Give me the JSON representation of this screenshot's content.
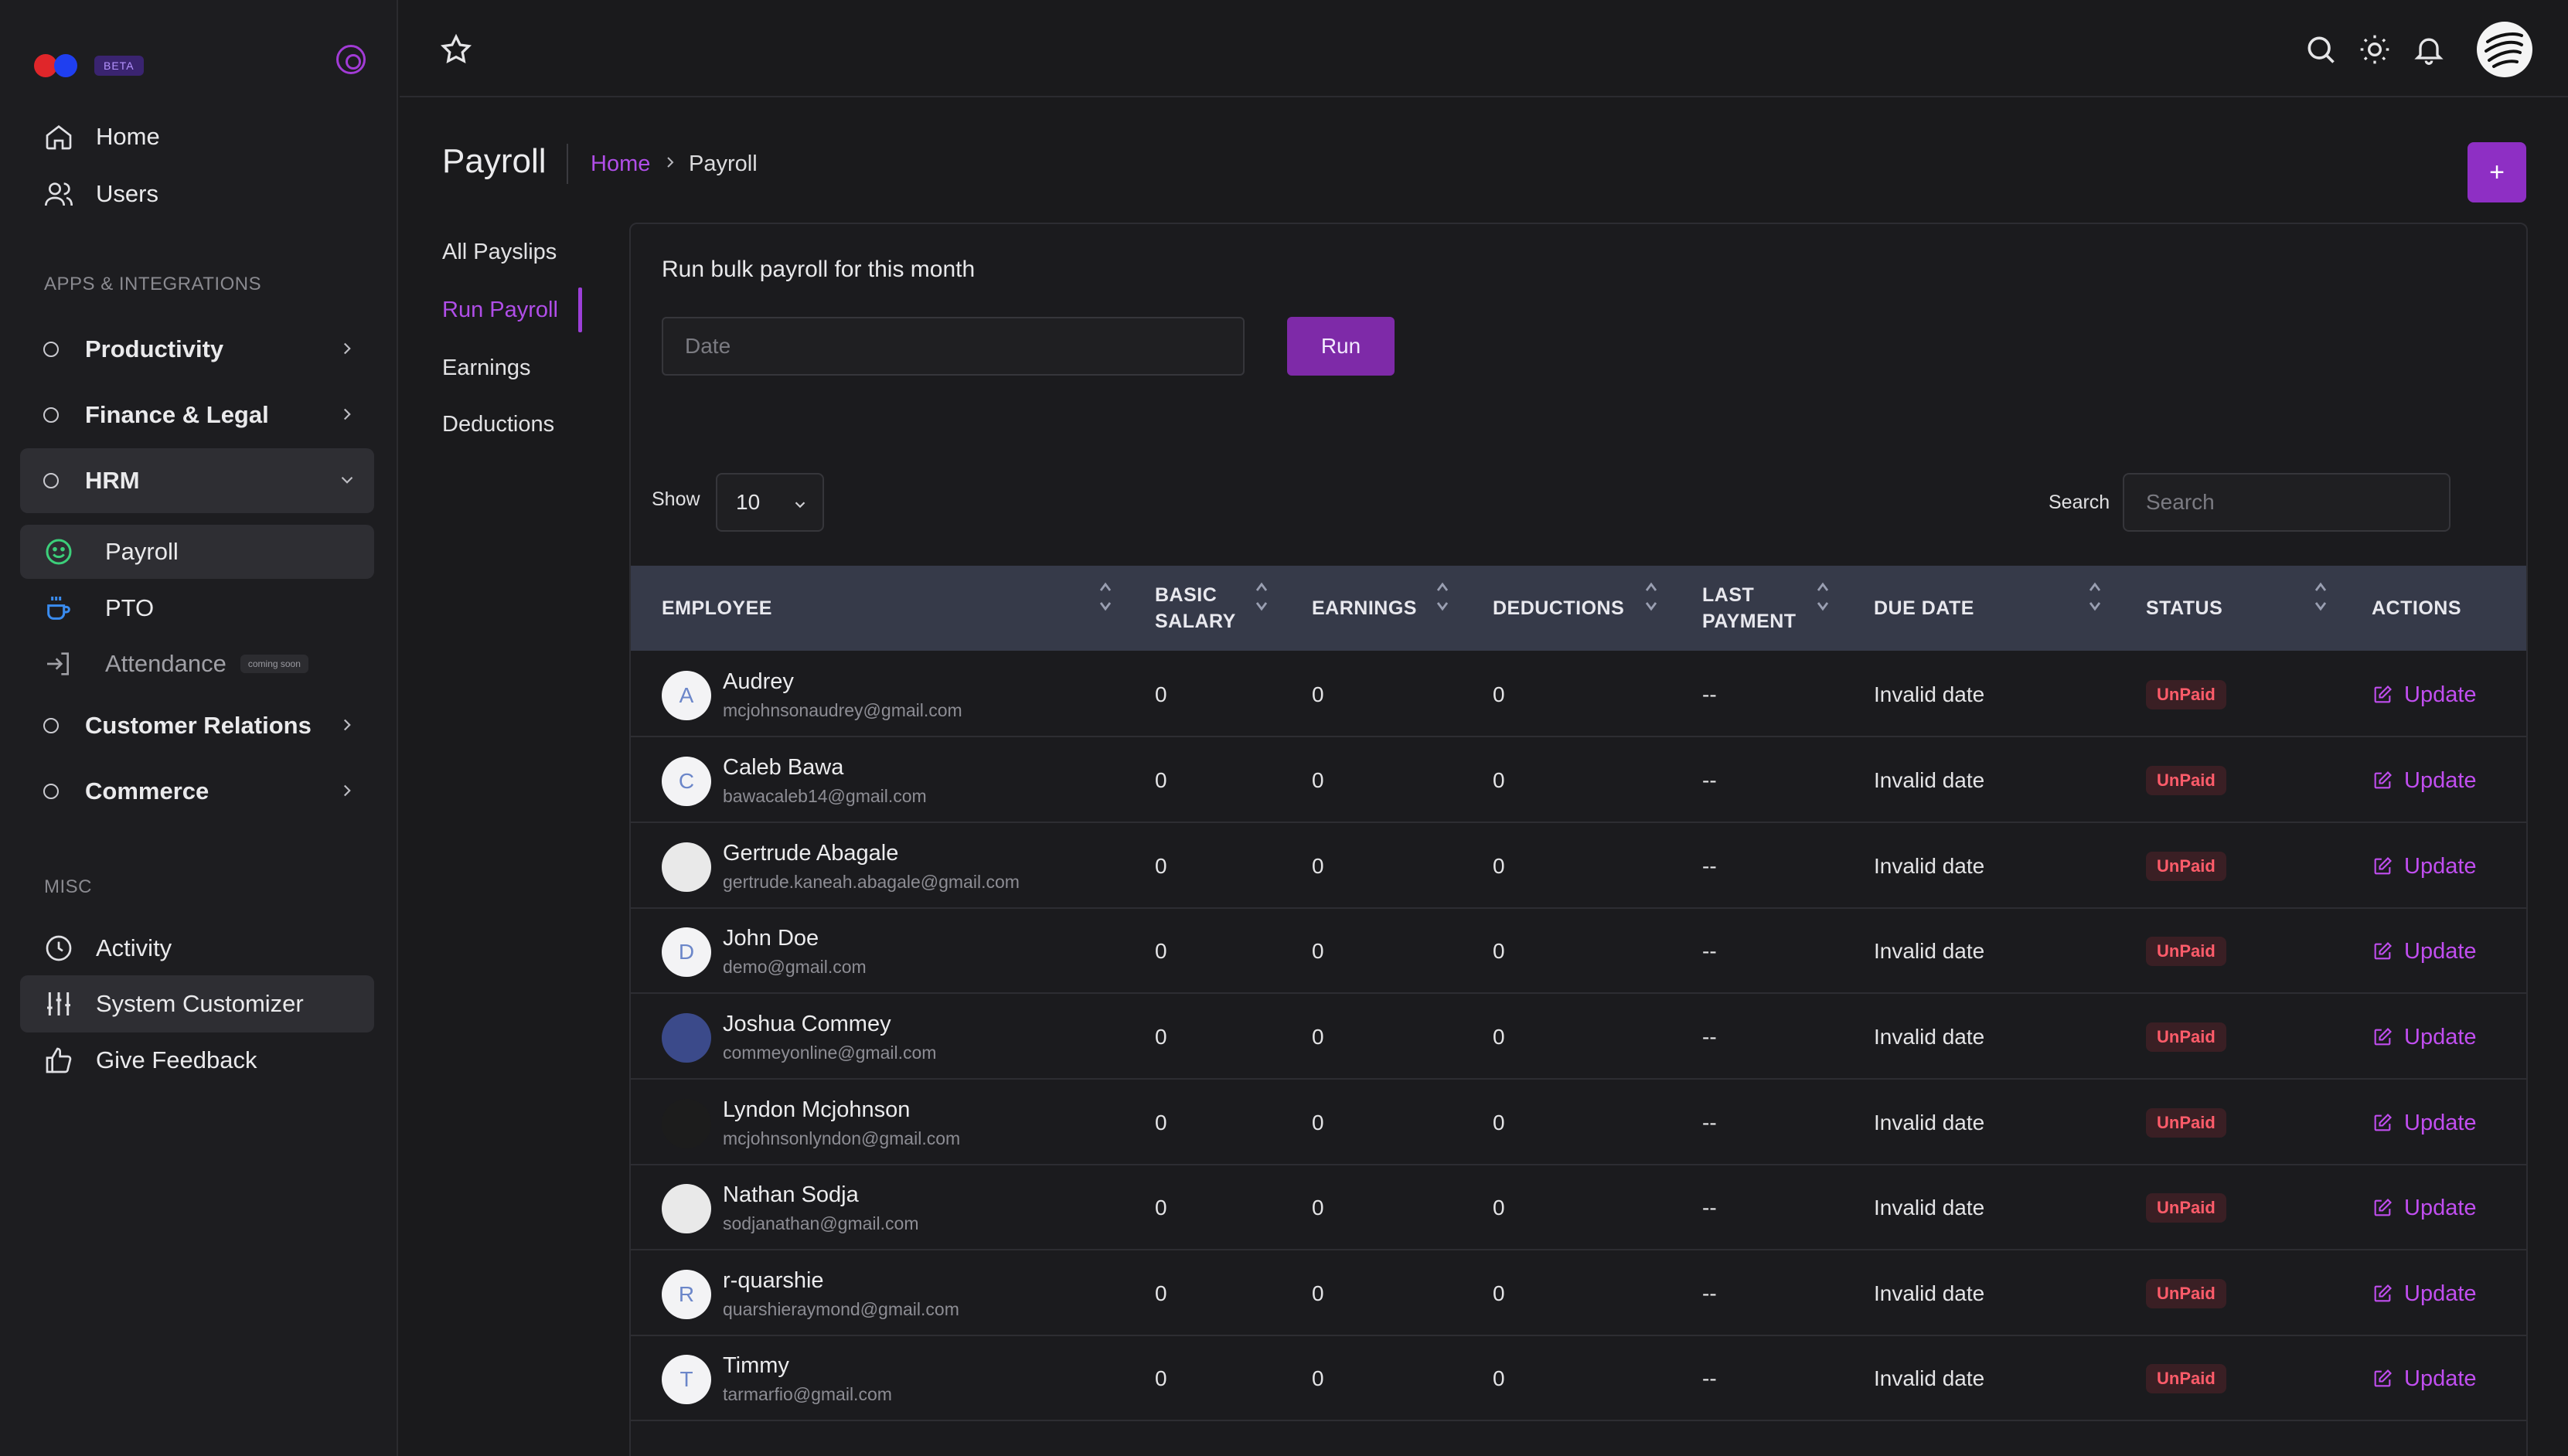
{
  "sidebar": {
    "beta": "BETA",
    "top_items": [
      {
        "label": "Home",
        "icon": "home-icon"
      },
      {
        "label": "Users",
        "icon": "users-icon"
      }
    ],
    "apps_label": "APPS & INTEGRATIONS",
    "groups": {
      "productivity": "Productivity",
      "finance": "Finance & Legal",
      "hrm": "HRM",
      "customer": "Customer Relations",
      "commerce": "Commerce"
    },
    "hrm_items": [
      {
        "label": "Payroll",
        "icon": "smile-icon"
      },
      {
        "label": "PTO",
        "icon": "coffee-icon"
      },
      {
        "label": "Attendance",
        "icon": "sign-in-icon",
        "badge": "coming soon"
      }
    ],
    "misc_label": "MISC",
    "misc_items": [
      {
        "label": "Activity",
        "icon": "clock-icon"
      },
      {
        "label": "System Customizer",
        "icon": "sliders-icon"
      },
      {
        "label": "Give Feedback",
        "icon": "thumbs-up-icon"
      }
    ]
  },
  "header": {
    "title": "Payroll",
    "breadcrumb_home": "Home",
    "breadcrumb_current": "Payroll",
    "add_label": "+"
  },
  "subnav": [
    "All Payslips",
    "Run Payroll",
    "Earnings",
    "Deductions"
  ],
  "bulk": {
    "heading": "Run bulk payroll for this month",
    "date_placeholder": "Date",
    "run_label": "Run"
  },
  "table_controls": {
    "show_label": "Show",
    "page_size": "10",
    "search_label": "Search",
    "search_placeholder": "Search"
  },
  "columns": [
    "EMPLOYEE",
    "BASIC\nSALARY",
    "EARNINGS",
    "DEDUCTIONS",
    "LAST\nPAYMENT",
    "DUE DATE",
    "STATUS",
    "ACTIONS"
  ],
  "rows": [
    {
      "initial": "A",
      "name": "Audrey",
      "email": "mcjohnsonaudrey@gmail.com",
      "basic": "0",
      "earnings": "0",
      "deductions": "0",
      "last": "--",
      "due": "Invalid date",
      "status": "UnPaid",
      "action": "Update"
    },
    {
      "initial": "C",
      "name": "Caleb Bawa",
      "email": "bawacaleb14@gmail.com",
      "basic": "0",
      "earnings": "0",
      "deductions": "0",
      "last": "--",
      "due": "Invalid date",
      "status": "UnPaid",
      "action": "Update"
    },
    {
      "initial": "",
      "name": "Gertrude Abagale",
      "email": "gertrude.kaneah.abagale@gmail.com",
      "basic": "0",
      "earnings": "0",
      "deductions": "0",
      "last": "--",
      "due": "Invalid date",
      "status": "UnPaid",
      "action": "Update"
    },
    {
      "initial": "D",
      "name": "John Doe",
      "email": "demo@gmail.com",
      "basic": "0",
      "earnings": "0",
      "deductions": "0",
      "last": "--",
      "due": "Invalid date",
      "status": "UnPaid",
      "action": "Update"
    },
    {
      "initial": "",
      "name": "Joshua Commey",
      "email": "commeyonline@gmail.com",
      "basic": "0",
      "earnings": "0",
      "deductions": "0",
      "last": "--",
      "due": "Invalid date",
      "status": "UnPaid",
      "action": "Update"
    },
    {
      "initial": "",
      "name": "Lyndon Mcjohnson",
      "email": "mcjohnsonlyndon@gmail.com",
      "basic": "0",
      "earnings": "0",
      "deductions": "0",
      "last": "--",
      "due": "Invalid date",
      "status": "UnPaid",
      "action": "Update"
    },
    {
      "initial": "",
      "name": "Nathan Sodja",
      "email": "sodjanathan@gmail.com",
      "basic": "0",
      "earnings": "0",
      "deductions": "0",
      "last": "--",
      "due": "Invalid date",
      "status": "UnPaid",
      "action": "Update"
    },
    {
      "initial": "R",
      "name": "r-quarshie",
      "email": "quarshieraymond@gmail.com",
      "basic": "0",
      "earnings": "0",
      "deductions": "0",
      "last": "--",
      "due": "Invalid date",
      "status": "UnPaid",
      "action": "Update"
    },
    {
      "initial": "T",
      "name": "Timmy",
      "email": "tarmarfio@gmail.com",
      "basic": "0",
      "earnings": "0",
      "deductions": "0",
      "last": "--",
      "due": "Invalid date",
      "status": "UnPaid",
      "action": "Update"
    }
  ],
  "colors": {
    "accent": "#8e2fc4",
    "link": "#b04ee8",
    "unpaid_text": "#ff5c6a",
    "table_header": "#363a49"
  }
}
